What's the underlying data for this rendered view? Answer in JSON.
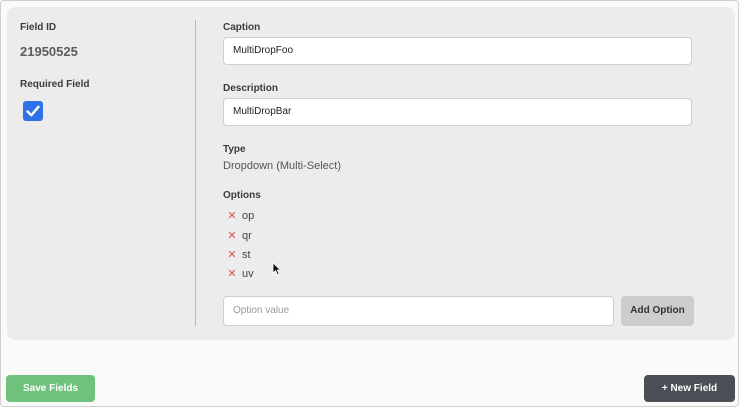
{
  "field_id": {
    "label": "Field ID",
    "value": "21950525"
  },
  "required": {
    "label": "Required Field",
    "checked": true
  },
  "caption": {
    "label": "Caption",
    "value": "MultiDropFoo"
  },
  "description": {
    "label": "Description",
    "value": "MultiDropBar"
  },
  "type": {
    "label": "Type",
    "value": "Dropdown (Multi-Select)"
  },
  "options": {
    "label": "Options",
    "items": [
      {
        "remove_glyph": "✕",
        "value": "op"
      },
      {
        "remove_glyph": "✕",
        "value": "qr"
      },
      {
        "remove_glyph": "✕",
        "value": "st"
      },
      {
        "remove_glyph": "✕",
        "value": "uv"
      }
    ],
    "input_placeholder": "Option value",
    "add_label": "Add Option"
  },
  "footer": {
    "save_label": "Save Fields",
    "new_label": "+ New Field"
  },
  "colors": {
    "checkbox": "#2f72e8",
    "remove": "#d9534f",
    "save": "#6fc27b",
    "new": "#4a4f56"
  }
}
